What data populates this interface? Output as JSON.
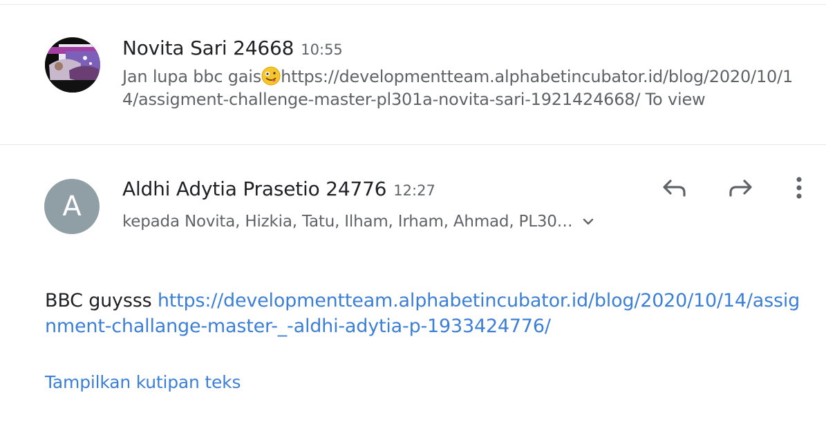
{
  "messages": [
    {
      "sender": "Novita Sari 24668",
      "time": "10:55",
      "snippet_before": "Jan lupa bbc gais",
      "snippet_emoji_icon": "zany-face-emoji-icon",
      "snippet_after": "https://developmentteam.alphabetincubator.id/blog/2020/10/14/assigment-challenge-master-pl301a-novita-sari-1921424668/ To view"
    },
    {
      "avatar_letter": "A",
      "sender": "Aldhi Adytia Prasetio 24776",
      "time": "12:27",
      "recipients": "kepada Novita, Hizkia, Tatu, Ilham, Irham, Ahmad, PL30…",
      "body_text": "BBC guysss ",
      "body_link": "https://developmentteam.alphabetincubator.id/blog/2020/10/14/assignment-challange-master-_-aldhi-adytia-p-1933424776/",
      "show_quoted": "Tampilkan kutipan teks"
    }
  ],
  "icons": {
    "reply": "reply-icon",
    "forward": "forward-icon",
    "more": "more-vert-icon",
    "expand": "chevron-down-icon"
  },
  "colors": {
    "link": "#3b7fd6",
    "avatar_bg": "#909fa6",
    "secondary_text": "#5f6368",
    "icon": "#5f6368"
  }
}
